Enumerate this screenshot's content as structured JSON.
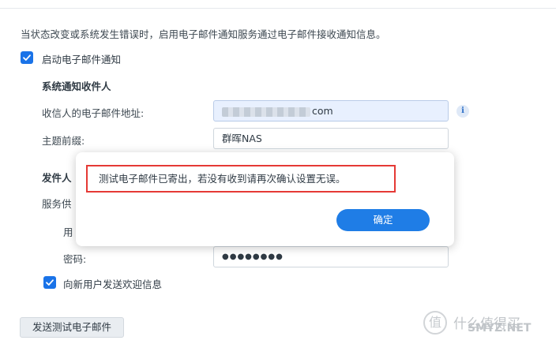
{
  "description": "当状态改变或系统发生错误时，启用电子邮件通知服务通过电子邮件接收通知信息。",
  "enable_checkbox": {
    "label": "启动电子邮件通知",
    "checked": true
  },
  "recipient_section": {
    "title": "系统通知收件人"
  },
  "email_field": {
    "label": "收信人的电子邮件地址:",
    "value_suffix": "com"
  },
  "subject_field": {
    "label": "主题前缀:",
    "value": "群晖NAS"
  },
  "sender_section": {
    "title": "发件人"
  },
  "provider_field": {
    "label": "服务供"
  },
  "username_field": {
    "label": "用"
  },
  "password_field": {
    "label": "密码:",
    "value": "●●●●●●●●"
  },
  "welcome_checkbox": {
    "label": "向新用户发送欢迎信息",
    "checked": true
  },
  "test_button": {
    "label": "发送测试电子邮件"
  },
  "dialog": {
    "message": "测试电子邮件已寄出，若没有收到请再次确认设置无误。",
    "ok_label": "确定"
  },
  "watermark": {
    "line1": "什么值得买",
    "line2": "SMYZ.NET",
    "logo": "值"
  },
  "colors": {
    "accent": "#1f7de6",
    "highlight_border": "#e53935",
    "checkbox": "#1a73e8"
  },
  "icons": {
    "info": "info-icon",
    "check": "check-icon"
  }
}
